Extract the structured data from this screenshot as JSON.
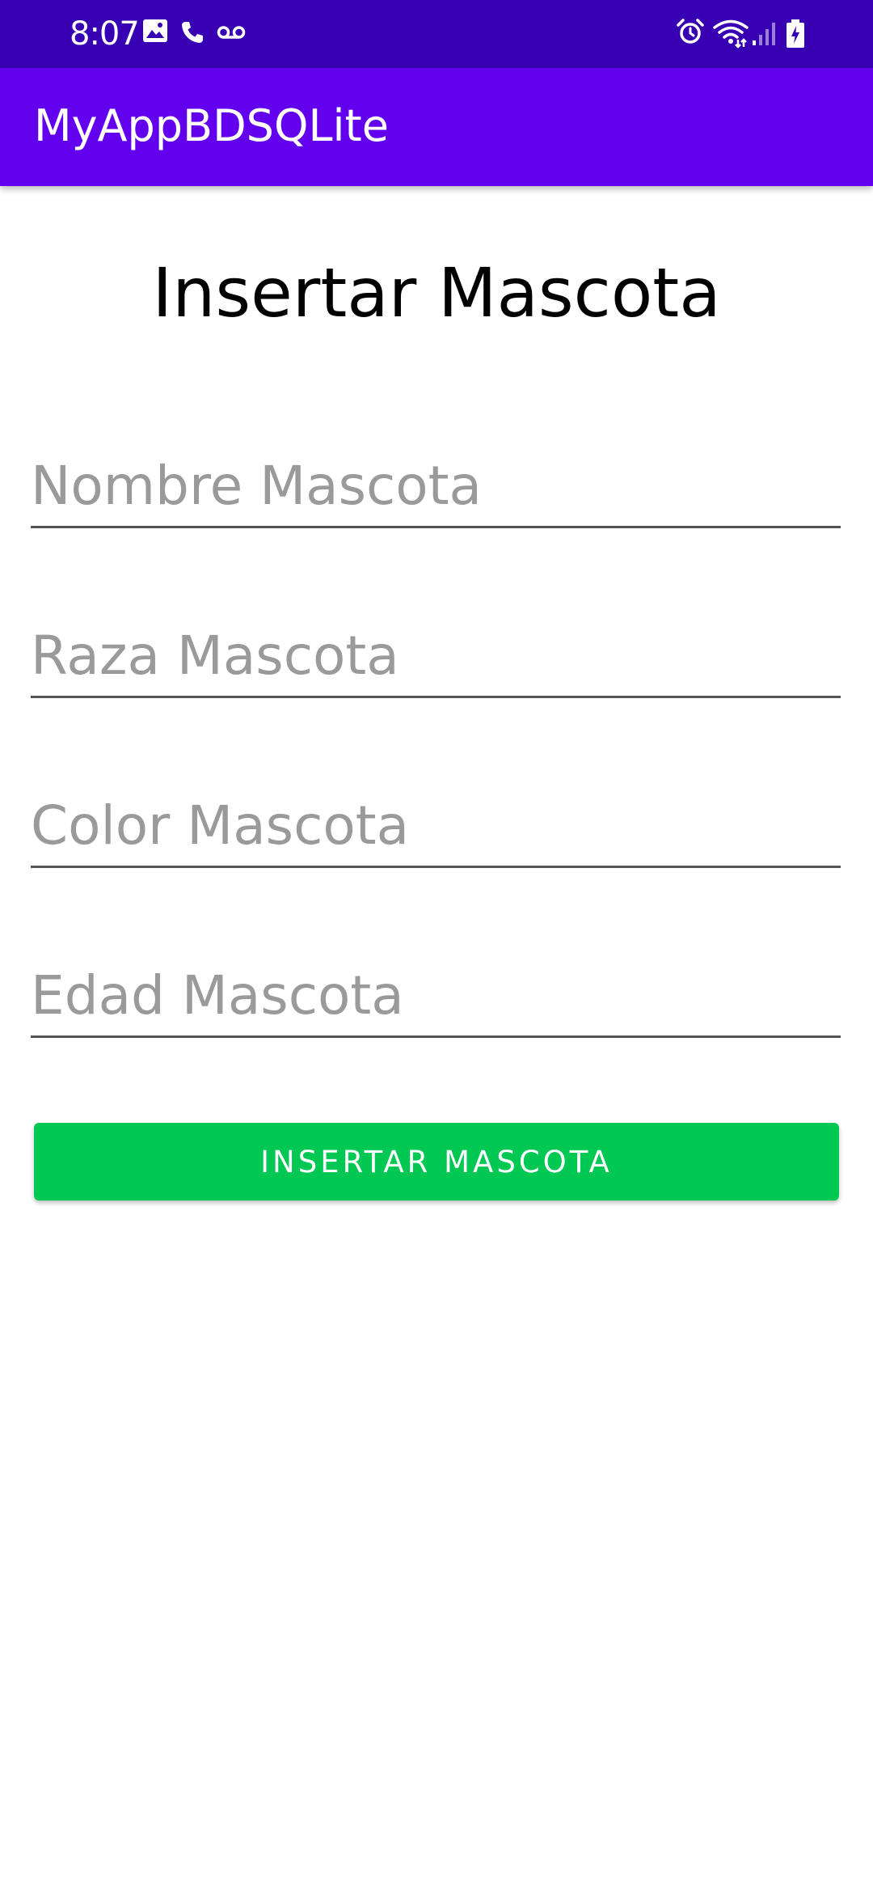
{
  "status_bar": {
    "time": "8:07",
    "left_icons": [
      "gallery-icon",
      "phone-icon",
      "voicemail-icon"
    ],
    "right_icons": [
      "alarm-icon",
      "wifi-icon",
      "signal-icon",
      "battery-icon"
    ],
    "background": "#3700b3"
  },
  "app_bar": {
    "title": "MyAppBDSQLite",
    "background": "#6200ee"
  },
  "main": {
    "title": "Insertar Mascota",
    "fields": [
      {
        "placeholder": "Nombre Mascota",
        "value": ""
      },
      {
        "placeholder": "Raza Mascota",
        "value": ""
      },
      {
        "placeholder": "Color Mascota",
        "value": ""
      },
      {
        "placeholder": "Edad Mascota",
        "value": ""
      }
    ],
    "submit_label": "INSERTAR MASCOTA",
    "submit_color": "#00c853"
  }
}
